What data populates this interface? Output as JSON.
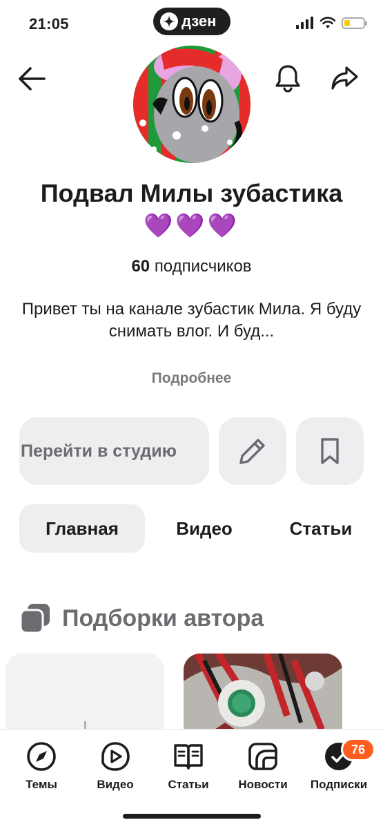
{
  "status_bar": {
    "time": "21:05",
    "app_pill": "дзен"
  },
  "channel": {
    "title": "Подвал Милы зубастика",
    "emoji": "💜💜💜",
    "subscribers_count": "60",
    "subscribers_label": "подписчиков",
    "description": "Привет ты на канале зубастик Мила. Я  буду снимать влог. И буд...",
    "more_label": "Подробнее"
  },
  "actions": {
    "studio_label": "Перейти в студию"
  },
  "tabs": [
    {
      "label": "Главная",
      "active": true
    },
    {
      "label": "Видео",
      "active": false
    },
    {
      "label": "Статьи",
      "active": false
    }
  ],
  "section": {
    "title": "Подборки автора"
  },
  "bottom_nav": [
    {
      "label": "Темы",
      "icon": "compass-icon"
    },
    {
      "label": "Видео",
      "icon": "play-icon"
    },
    {
      "label": "Статьи",
      "icon": "book-icon"
    },
    {
      "label": "Новости",
      "icon": "news-icon"
    },
    {
      "label": "Подписки",
      "icon": "subscriptions-icon",
      "badge": "76"
    }
  ],
  "colors": {
    "accent_badge": "#ff5c1f",
    "heart": "#9b3de8",
    "button_bg": "#eeeef0"
  }
}
